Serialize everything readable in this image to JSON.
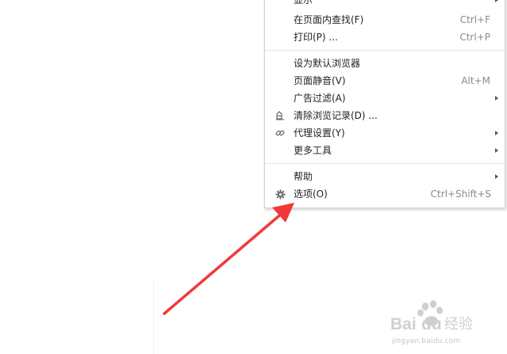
{
  "menu": {
    "items": [
      {
        "label": "显示",
        "shortcut": "",
        "submenu": true,
        "icon": ""
      },
      {
        "label": "在页面内查找(F)",
        "shortcut": "Ctrl+F",
        "submenu": false,
        "icon": ""
      },
      {
        "label": "打印(P) ...",
        "shortcut": "Ctrl+P",
        "submenu": false,
        "icon": ""
      },
      {
        "label": "设为默认浏览器",
        "shortcut": "",
        "submenu": false,
        "icon": ""
      },
      {
        "label": "页面静音(V)",
        "shortcut": "Alt+M",
        "submenu": false,
        "icon": ""
      },
      {
        "label": "广告过滤(A)",
        "shortcut": "",
        "submenu": true,
        "icon": ""
      },
      {
        "label": "清除浏览记录(D) ...",
        "shortcut": "",
        "submenu": false,
        "icon": "eraser-icon"
      },
      {
        "label": "代理设置(Y)",
        "shortcut": "",
        "submenu": true,
        "icon": "link-icon"
      },
      {
        "label": "更多工具",
        "shortcut": "",
        "submenu": true,
        "icon": ""
      },
      {
        "label": "帮助",
        "shortcut": "",
        "submenu": true,
        "icon": ""
      },
      {
        "label": "选项(O)",
        "shortcut": "Ctrl+Shift+S",
        "submenu": false,
        "icon": "gear-icon"
      }
    ]
  },
  "annotation": {
    "arrow_color": "#f03a3a"
  },
  "watermark": {
    "logo_text": "Baidu 经验",
    "url": "jingyan.baidu.com"
  }
}
